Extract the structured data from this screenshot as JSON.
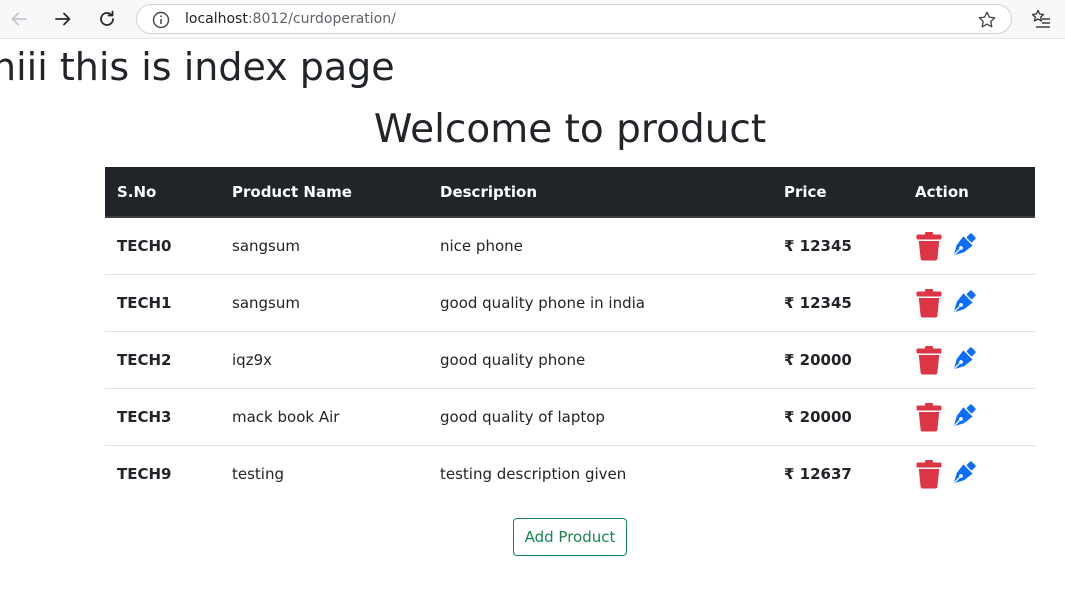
{
  "browser": {
    "url_host": "localhost",
    "url_path": ":8012/curdoperation/"
  },
  "page": {
    "index_heading": "hiii this is index page",
    "welcome_heading": "Welcome to product"
  },
  "table": {
    "headers": {
      "sno": "S.No",
      "name": "Product Name",
      "description": "Description",
      "price": "Price",
      "action": "Action"
    },
    "rows": [
      {
        "sno": "TECH0",
        "name": "sangsum",
        "description": "nice phone",
        "price": "₹ 12345"
      },
      {
        "sno": "TECH1",
        "name": "sangsum",
        "description": "good quality phone in india",
        "price": "₹ 12345"
      },
      {
        "sno": "TECH2",
        "name": "iqz9x",
        "description": "good quality phone",
        "price": "₹ 20000"
      },
      {
        "sno": "TECH3",
        "name": "mack book Air",
        "description": "good quality of laptop",
        "price": "₹ 20000"
      },
      {
        "sno": "TECH9",
        "name": "testing",
        "description": "testing description given",
        "price": "₹ 12637"
      }
    ]
  },
  "buttons": {
    "add_product": "Add Product"
  },
  "colors": {
    "delete_icon": "#dc3545",
    "edit_icon": "#0d6efd",
    "add_button": "#198754",
    "table_header_bg": "#212529"
  },
  "icons": {
    "delete": "trash-icon",
    "edit": "pen-icon"
  }
}
